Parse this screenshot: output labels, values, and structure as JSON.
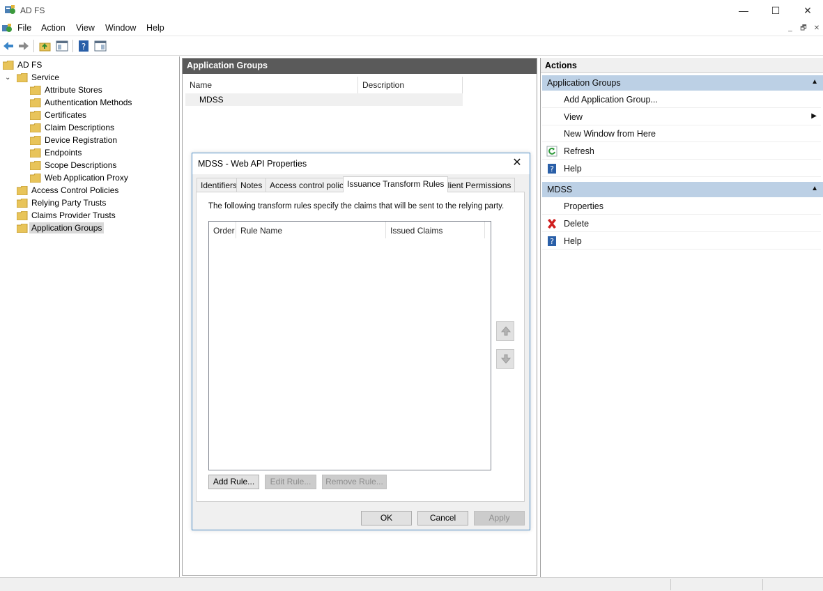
{
  "window": {
    "title": "AD FS",
    "controls": {
      "minimize": "—",
      "maximize": "☐",
      "close": "✕"
    }
  },
  "menubar": {
    "items": [
      "File",
      "Action",
      "View",
      "Window",
      "Help"
    ],
    "mdi": {
      "minimize": "_",
      "restore": "🗗",
      "close": "✕"
    }
  },
  "tree": {
    "root": "AD FS",
    "service": "Service",
    "service_children": [
      "Attribute Stores",
      "Authentication Methods",
      "Certificates",
      "Claim Descriptions",
      "Device Registration",
      "Endpoints",
      "Scope Descriptions",
      "Web Application Proxy"
    ],
    "top_level": [
      "Access Control Policies",
      "Relying Party Trusts",
      "Claims Provider Trusts",
      "Application Groups"
    ],
    "selected": "Application Groups"
  },
  "center": {
    "header": "Application Groups",
    "columns": [
      "Name",
      "Description"
    ],
    "rows": [
      {
        "name": "MDSS",
        "description": ""
      }
    ]
  },
  "actions": {
    "title": "Actions",
    "sections": [
      {
        "label": "Application Groups",
        "items": [
          {
            "label": "Add Application Group...",
            "icon": ""
          },
          {
            "label": "View",
            "icon": "",
            "submenu": "▶"
          },
          {
            "label": "New Window from Here",
            "icon": ""
          },
          {
            "label": "Refresh",
            "icon": "refresh-icon"
          },
          {
            "label": "Help",
            "icon": "help-icon"
          }
        ]
      },
      {
        "label": "MDSS",
        "items": [
          {
            "label": "Properties",
            "icon": ""
          },
          {
            "label": "Delete",
            "icon": "delete-icon"
          },
          {
            "label": "Help",
            "icon": "help-icon"
          }
        ]
      }
    ]
  },
  "dialog": {
    "title": "MDSS - Web API Properties",
    "close": "✕",
    "tabs": [
      "Identifiers",
      "Notes",
      "Access control policy",
      "Issuance Transform Rules",
      "Client Permissions"
    ],
    "active_tab": "Issuance Transform Rules",
    "description": "The following transform rules specify the claims that will be sent to the relying party.",
    "table_columns": [
      "Order",
      "Rule Name",
      "Issued Claims"
    ],
    "rule_buttons": {
      "add": "Add Rule...",
      "edit": "Edit Rule...",
      "remove": "Remove Rule..."
    },
    "footer_buttons": {
      "ok": "OK",
      "cancel": "Cancel",
      "apply": "Apply"
    }
  },
  "colors": {
    "header_dark": "#5a5a5a",
    "actions_section": "#bcd0e5",
    "dialog_border": "#4f8fc7",
    "folder": "#e8c45a"
  }
}
